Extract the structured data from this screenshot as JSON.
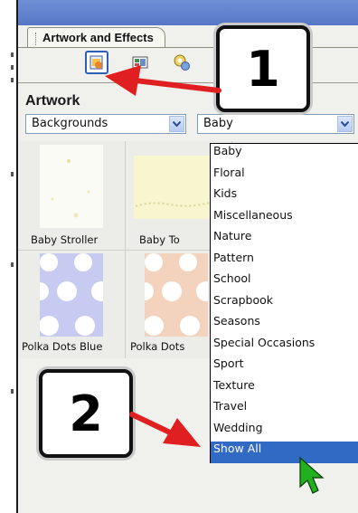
{
  "panel": {
    "tab_title": "Artwork and Effects",
    "section_title": "Artwork",
    "toolbar": {
      "icons": [
        "artwork-icon",
        "backgrounds-icon",
        "effects-icon"
      ],
      "selected": "artwork-icon"
    },
    "category_select": {
      "value": "Backgrounds"
    },
    "subcategory_select": {
      "value": "Baby",
      "options": [
        "Baby",
        "Floral",
        "Kids",
        "Miscellaneous",
        "Nature",
        "Pattern",
        "School",
        "Scrapbook",
        "Seasons",
        "Special Occasions",
        "Sport",
        "Texture",
        "Travel",
        "Wedding",
        "Show All"
      ],
      "highlighted": "Show All"
    },
    "thumbnails": [
      {
        "label": "Baby Stroller"
      },
      {
        "label": "Baby To"
      },
      {
        "label": "Polka Dots Blue"
      },
      {
        "label": "Polka Dots"
      }
    ]
  },
  "callouts": [
    "1",
    "2"
  ],
  "colors": {
    "accent": "#e02020",
    "highlight": "#316ac5",
    "cursor": "#22b01e"
  }
}
